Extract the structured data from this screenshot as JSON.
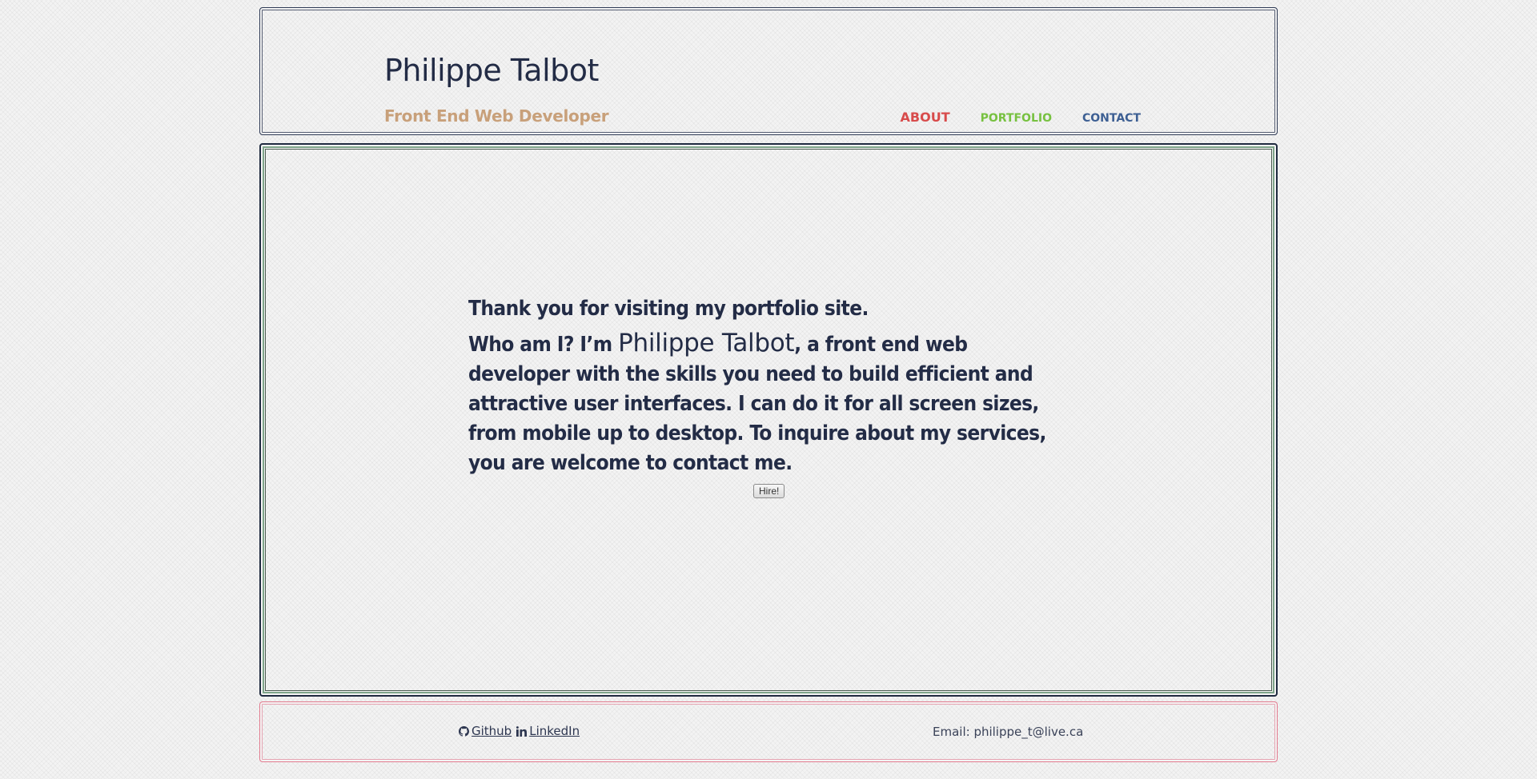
{
  "header": {
    "title": "Philippe Talbot",
    "subtitle": "Front End Web Developer",
    "nav": {
      "about": "ABOUT",
      "portfolio": "PORTFOLIO",
      "contact": "CONTACT"
    }
  },
  "main": {
    "thanks": "Thank you for visiting my portfolio site.",
    "bio_prefix": "Who am I? I’m ",
    "bio_name": "Philippe Talbot",
    "bio_suffix": ", a front end web developer with the skills you need to build efficient and attractive user interfaces. I can do it for all screen sizes, from mobile up to desktop. To inquire about my services, you are welcome to contact me.",
    "hire_label": "Hire!"
  },
  "footer": {
    "github_label": " Github",
    "linkedin_label": " LinkedIn",
    "email_text": "Email: philippe_t@live.ca"
  },
  "icons": {
    "github": "github-icon",
    "linkedin": "linkedin-icon"
  },
  "colors": {
    "title": "#232c46",
    "subtitle": "#c8a07a",
    "nav_about": "#d84b4b",
    "nav_portfolio": "#77c140",
    "nav_contact": "#3d5f93",
    "footer_border": "#e27a8e",
    "main_border_inner": "#7fa58a"
  }
}
